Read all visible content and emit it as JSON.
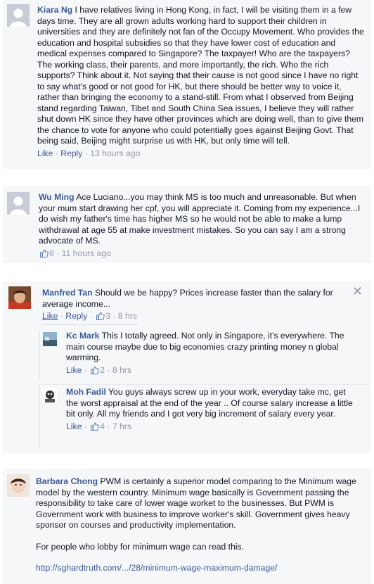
{
  "comments": [
    {
      "name": "Kiara Ng",
      "text": "I have relatives living in Hong Kong, in fact, I will be visiting them in a few days time. They are all grown adults working hard to support their children in universities and they are definitely not fan of the Occupy Movement. Who provides the education and hospital subsidies so that they have lower cost of education and medical expenses compared to Singapore? The taxpayer! Who are the taxpayers? The working class, their parents, and more importantly, the rich. Who the rich supports? Think about it. Not saying that their cause is not good since I have no right to say what's good or not good for HK, but there should be better way to voice it, rather than bringing the economy to a stand-still. From what I observed from Beijing stand regarding Taiwan, Tibet and South China Sea issues, I believe they will rather shut down HK since they have other provinces which are doing well, than to give them the chance to vote for anyone who could potentially goes against Beijing Govt. That being said, Beijing might surprise us with HK, but only time will tell.",
      "like": "Like",
      "reply": "Reply",
      "time": "13 hours ago"
    },
    {
      "name": "Wu Ming",
      "text": "Ace Luciano...you may think MS is too much and unreasonable. But when your mum start drawing her cpf, you will appreciate it. Coming from my experience...I do wish my father's time has higher MS so he would not be able to make a lump withdrawal at age 55 at make investment mistakes. So you can say I am a strong advocate of MS.",
      "likes": "8",
      "time": "11 hours ago"
    },
    {
      "name": "Manfred Tan",
      "text": "Should we be happy? Prices increase faster than the salary for average income...",
      "like": "Like",
      "reply": "Reply",
      "likes": "3",
      "time": "8 hrs",
      "close": "✕",
      "replies": [
        {
          "name": "Kc Mark",
          "text": "This I totally agreed. Not only in Singapore, it's everywhere. The main course maybe due to big economies crazy printing money n global warming.",
          "like": "Like",
          "likes": "2",
          "time": "8 hrs"
        },
        {
          "name": "Moh Fadil",
          "text": "You guys always screw up in your work, everyday take mc, get the worst appraisal at the end of the year .. Of course salary increase a little bit only. All my friends and I got very big increment of salary every year.",
          "like": "Like",
          "likes": "4",
          "time": "7 hrs"
        }
      ]
    },
    {
      "name": "Barbara Chong",
      "text": "PWM is certainly a superior model comparing to the Minimum wage model by the western country. Minimum wage basically is Government passing the responsibility to take care of lower wage worket to the businesses. But PWM is Government work with business to improve worker's skill. Government gives heavy sponsor on courses and productivity implementation.",
      "text2": "For people who lobby for minimum wage can read this.",
      "url": "http://sghardtruth.com/.../28/minimum-wage-maximum-damage/"
    }
  ],
  "separator": "·",
  "colors": {
    "link": "#3b5998",
    "meta": "#9197a3",
    "card_bg": "#f6f7f9"
  }
}
